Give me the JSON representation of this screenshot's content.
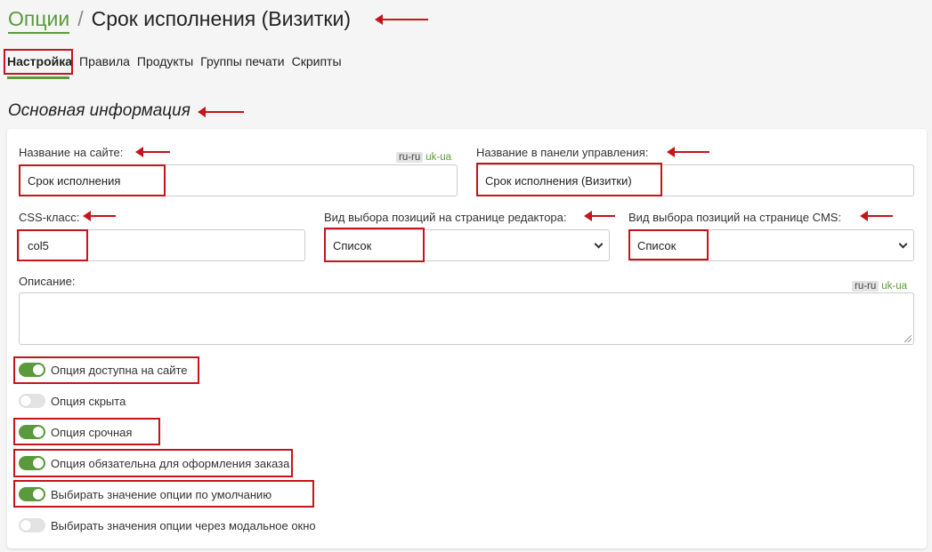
{
  "breadcrumb": {
    "parent": "Опции",
    "separator": "/",
    "title": "Срок исполнения (Визитки)"
  },
  "tabs": [
    "Настройка",
    "Правила",
    "Продукты",
    "Группы печати",
    "Скрипты"
  ],
  "section_title": "Основная информация",
  "form": {
    "site_name": {
      "label": "Название на сайте:",
      "value": "Срок исполнения"
    },
    "lang_site": {
      "active": "ru-ru",
      "other": "uk-ua"
    },
    "admin_name": {
      "label": "Название в панели управления:",
      "value": "Срок исполнения (Визитки)"
    },
    "css_class": {
      "label": "CSS-класс:",
      "value": "col5"
    },
    "editor_view": {
      "label": "Вид выбора позиций на странице редактора:",
      "value": "Список"
    },
    "cms_view": {
      "label": "Вид выбора позиций на странице CMS:",
      "value": "Список"
    },
    "description": {
      "label": "Описание:",
      "value": ""
    },
    "lang_desc": {
      "active": "ru-ru",
      "other": "uk-ua"
    }
  },
  "toggles": [
    {
      "label": "Опция доступна на сайте",
      "on": true
    },
    {
      "label": "Опция скрыта",
      "on": false
    },
    {
      "label": "Опция срочная",
      "on": true
    },
    {
      "label": "Опция обязательна для оформления заказа",
      "on": true
    },
    {
      "label": "Выбирать значение опции по умолчанию",
      "on": true
    },
    {
      "label": "Выбирать значения опции через модальное окно",
      "on": false
    }
  ],
  "colors": {
    "accent": "#5a9a3c",
    "annotation": "#c3151b",
    "switch_off": "#e3e3e3"
  }
}
